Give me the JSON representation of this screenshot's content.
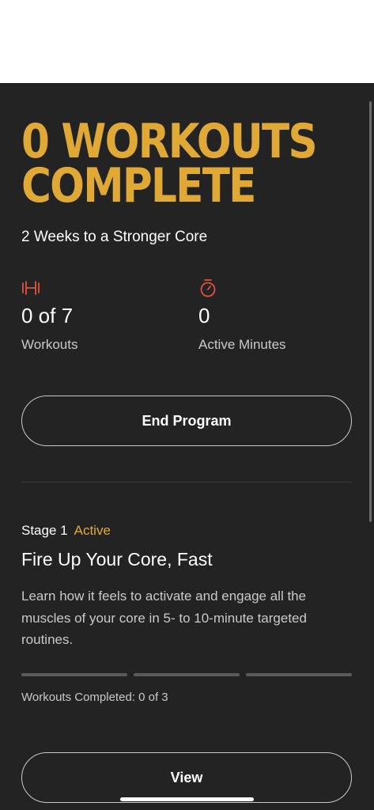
{
  "hero": {
    "title": "0 WORKOUTS COMPLETE",
    "accent_color": "#e0a935"
  },
  "program": {
    "name": "2 Weeks to a Stronger Core"
  },
  "stats": [
    {
      "icon": "dumbbell-icon",
      "value": "0 of 7",
      "label": "Workouts"
    },
    {
      "icon": "stopwatch-icon",
      "value": "0",
      "label": "Active Minutes"
    }
  ],
  "actions": {
    "end_program": "End Program",
    "view": "View"
  },
  "stage": {
    "label": "Stage 1",
    "status": "Active",
    "title": "Fire Up Your Core, Fast",
    "description": "Learn how it feels to activate and engage all the muscles of your core in 5- to 10-minute targeted routines.",
    "segments_total": 3,
    "segments_completed": 0,
    "completed_text": "Workouts Completed: 0 of 3"
  },
  "colors": {
    "background": "#232323",
    "icon": "#e2533c",
    "accent": "#e0a935"
  }
}
